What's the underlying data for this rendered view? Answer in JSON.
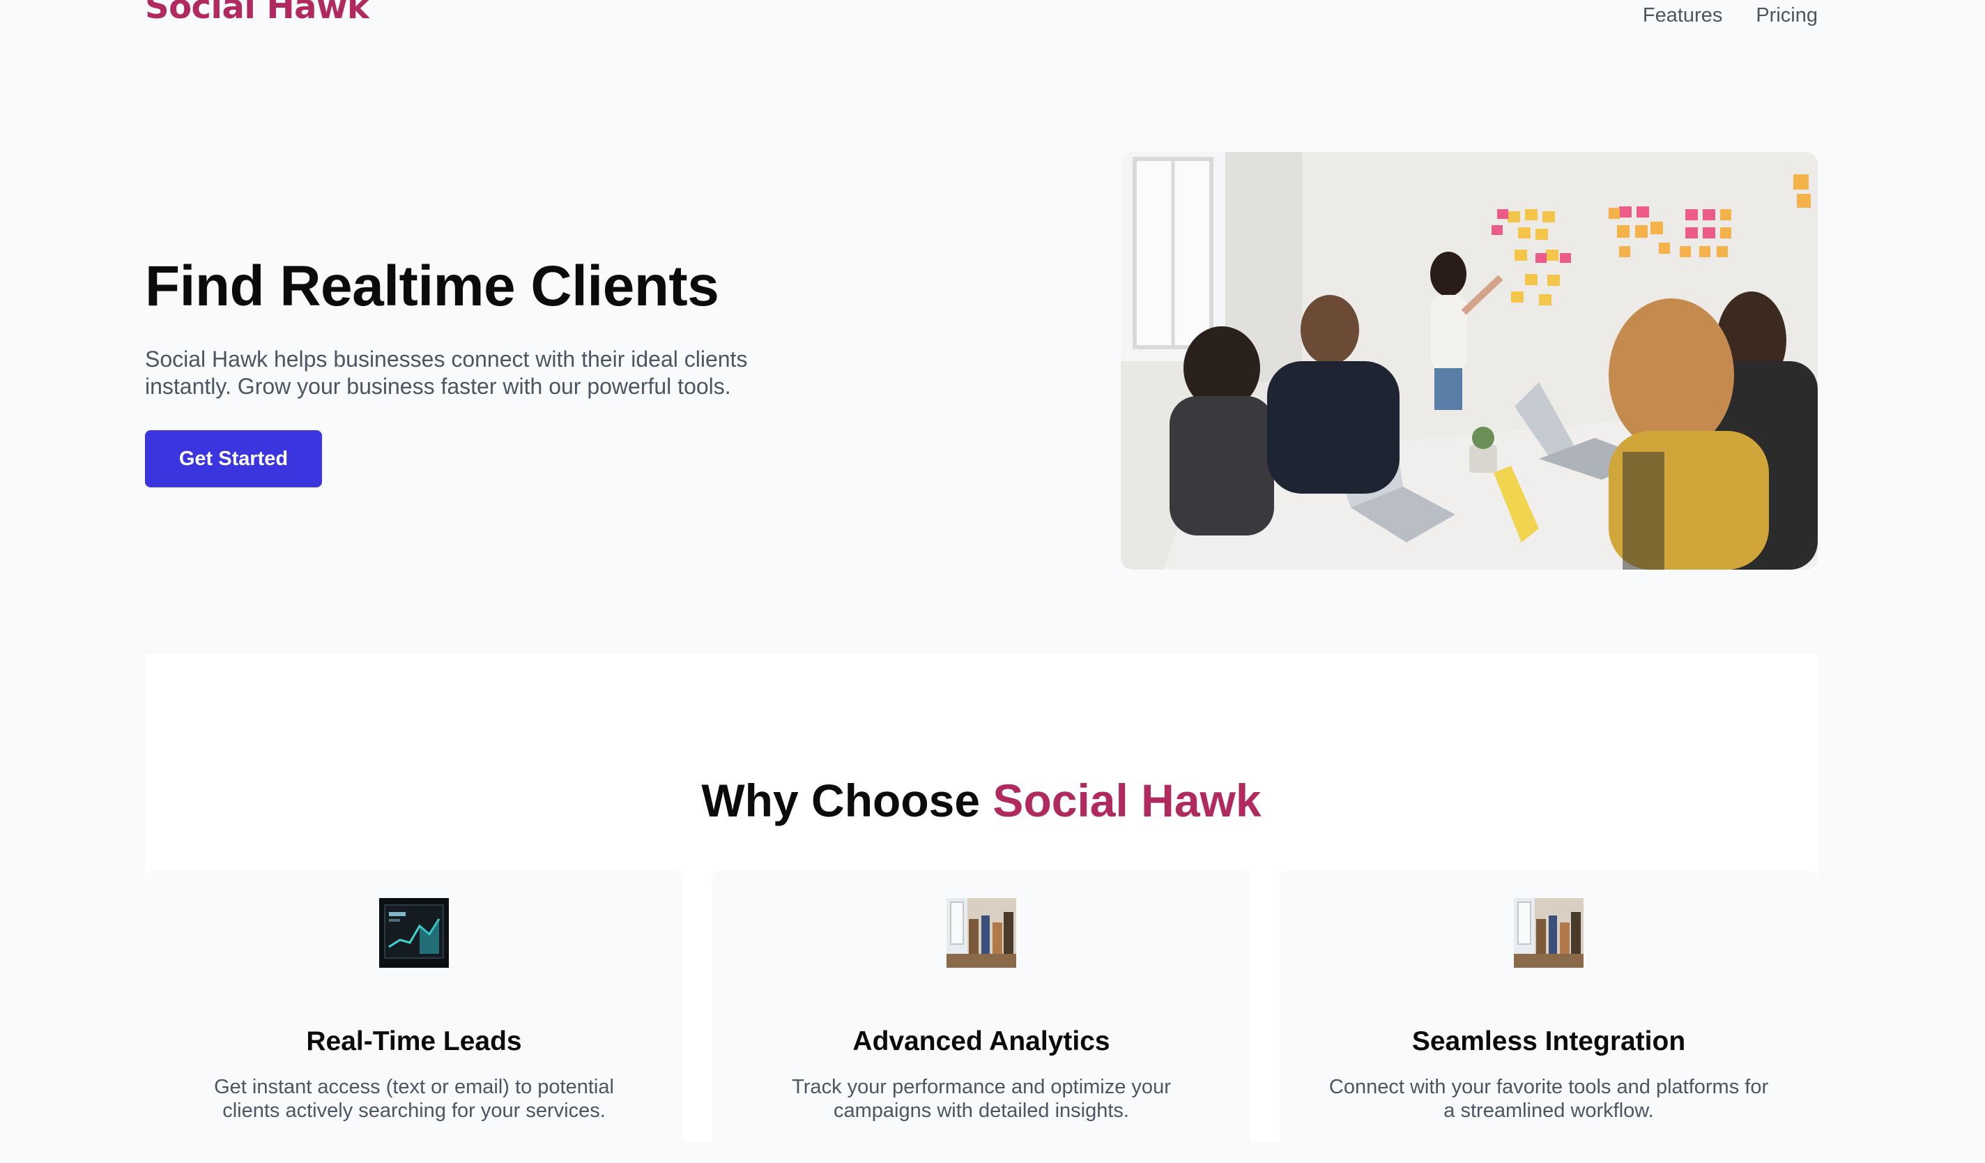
{
  "brand": {
    "name": "Social Hawk",
    "color": "#b02a5f"
  },
  "nav": {
    "items": [
      "Features",
      "Pricing"
    ]
  },
  "hero": {
    "title": "Find Realtime Clients",
    "description": "Social Hawk helps businesses connect with their ideal clients instantly. Grow your business faster with our powerful tools.",
    "cta_label": "Get Started",
    "cta_color": "#3b35e0",
    "image": "team-meeting-photo"
  },
  "features": {
    "title_prefix": "Why Choose",
    "title_accent": "Social Hawk",
    "cards": [
      {
        "icon": "analytics-dashboard-thumbnail",
        "title": "Real-Time Leads",
        "description": "Get instant access (text or email) to potential clients actively searching for your services."
      },
      {
        "icon": "office-team-thumbnail",
        "title": "Advanced Analytics",
        "description": "Track your performance and optimize your campaigns with detailed insights."
      },
      {
        "icon": "office-team-thumbnail",
        "title": "Seamless Integration",
        "description": "Connect with your favorite tools and platforms for a streamlined workflow."
      }
    ]
  }
}
